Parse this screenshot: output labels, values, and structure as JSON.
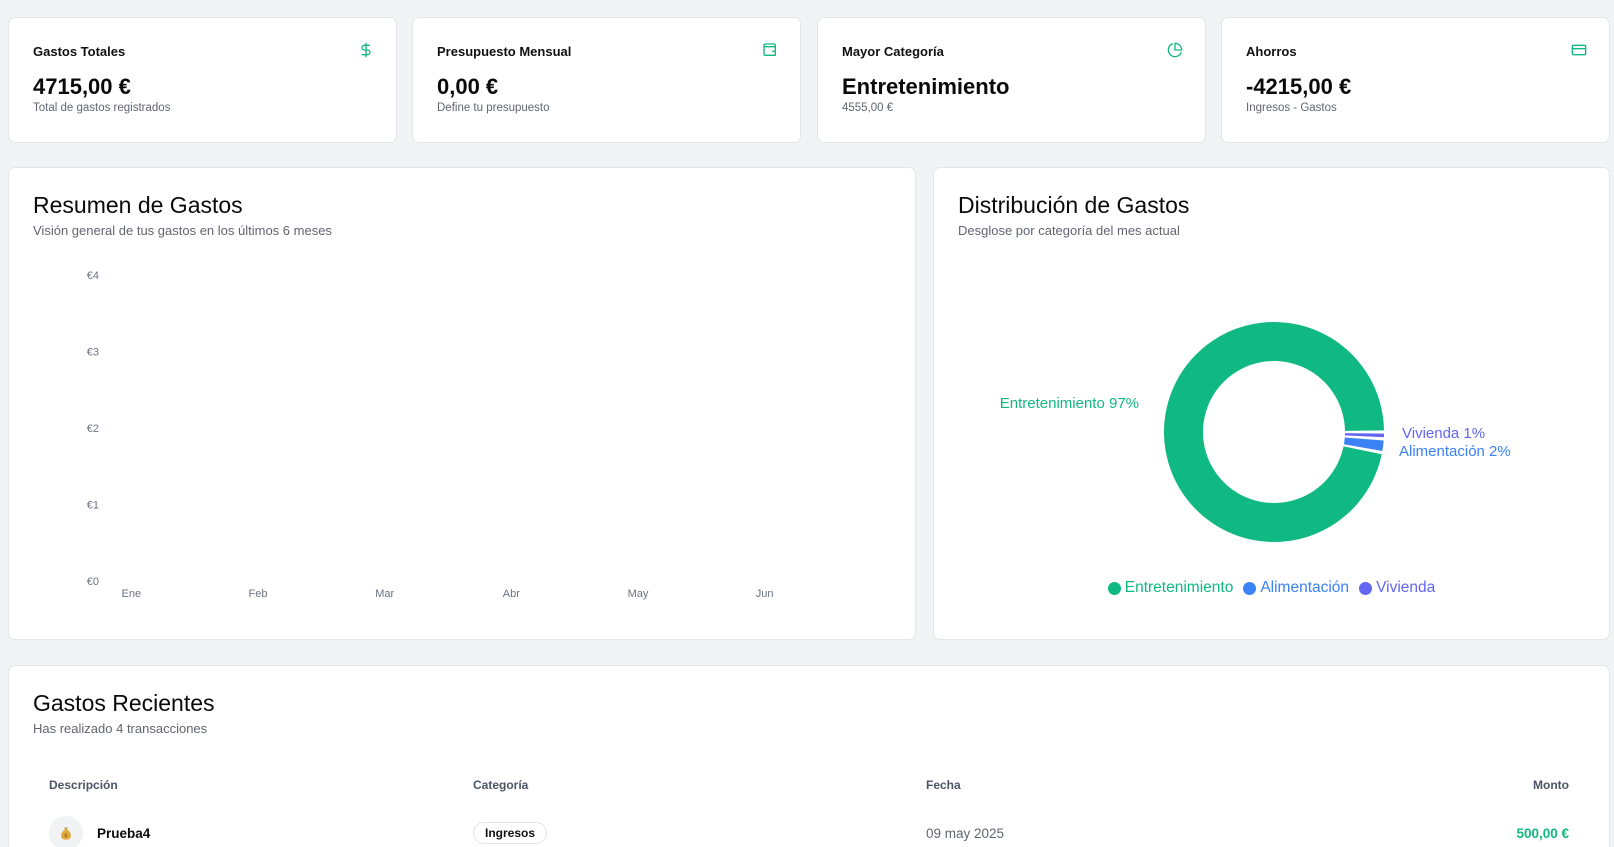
{
  "stats": [
    {
      "title": "Gastos Totales",
      "value": "4715,00 €",
      "sub": "Total de gastos registrados",
      "icon": "dollar-icon"
    },
    {
      "title": "Presupuesto Mensual",
      "value": "0,00 €",
      "sub": "Define tu presupuesto",
      "icon": "wallet-icon"
    },
    {
      "title": "Mayor Categoría",
      "value": "Entretenimiento",
      "sub": "4555,00 €",
      "icon": "pie-chart-icon"
    },
    {
      "title": "Ahorros",
      "value": "-4215,00 €",
      "sub": "Ingresos - Gastos",
      "icon": "credit-card-icon"
    }
  ],
  "summary": {
    "title": "Resumen de Gastos",
    "subtitle": "Visión general de tus gastos en los últimos 6 meses"
  },
  "distribution": {
    "title": "Distribución de Gastos",
    "subtitle": "Desglose por categoría del mes actual"
  },
  "recent": {
    "title": "Gastos Recientes",
    "subtitle": "Has realizado 4 transacciones",
    "headers": {
      "description": "Descripción",
      "category": "Categoría",
      "date": "Fecha",
      "amount": "Monto"
    },
    "rows": [
      {
        "icon": "money-bag-icon",
        "description": "Prueba4",
        "category": "Ingresos",
        "date": "09 may 2025",
        "amount": "500,00 €"
      }
    ]
  },
  "colors": {
    "accent": "#10b981",
    "entretenimiento": "#10b981",
    "alimentacion": "#3b82f6",
    "vivienda": "#6366f1"
  },
  "chart_data": [
    {
      "type": "bar",
      "categories": [
        "Ene",
        "Feb",
        "Mar",
        "Abr",
        "May",
        "Jun"
      ],
      "values": [
        0,
        0,
        0,
        0,
        0,
        0
      ],
      "yticks": [
        "€0",
        "€1",
        "€2",
        "€3",
        "€4"
      ],
      "ylim": [
        0,
        4
      ],
      "grid": false
    },
    {
      "type": "pie",
      "donut": true,
      "categories": [
        "Entretenimiento",
        "Alimentación",
        "Vivienda"
      ],
      "values": [
        97,
        2,
        1
      ],
      "labels": [
        "Entretenimiento 97%",
        "Alimentación 2%",
        "Vivienda 1%"
      ],
      "legend": "bottom"
    }
  ]
}
